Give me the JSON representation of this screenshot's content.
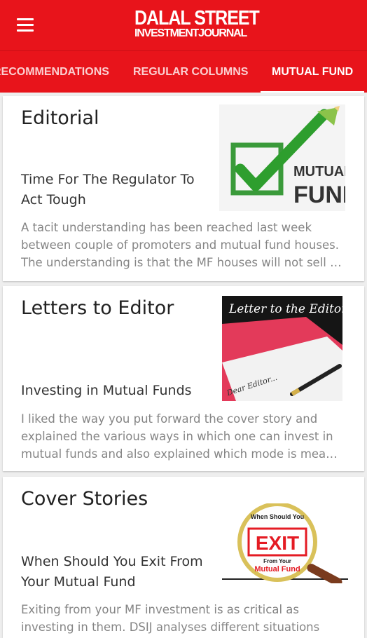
{
  "app": {
    "logo_line1": "DALAL STREET",
    "logo_line2": "INVESTMENTJOURNAL"
  },
  "tabs": [
    {
      "label": "RECOMMENDATIONS",
      "active": false
    },
    {
      "label": "REGULAR COLUMNS",
      "active": false
    },
    {
      "label": "MUTUAL FUND",
      "active": true
    }
  ],
  "colors": {
    "brand": "#e8141b",
    "tab_text": "#fbd0d1"
  },
  "cards": [
    {
      "section": "Editorial",
      "headline": "Time For The Regulator To Act Tough",
      "description_lines": [
        "A tacit understanding has been reached last week",
        "between couple of promoters and mutual fund houses.",
        "The understanding is that the MF houses will not sell …"
      ],
      "image": {
        "line1": "MUTUAL",
        "line2": "FUND",
        "icon": "checkmark-pencil-icon"
      }
    },
    {
      "section": "Letters to Editor",
      "headline": "Investing in Mutual Funds",
      "description_lines": [
        "I liked the way you put forward the cover story and",
        "explained the various ways in which one can invest in",
        "mutual funds and also explained which mode is mea…"
      ],
      "image": {
        "title": "Letter to the Editor",
        "handwriting": "Dear Editor...",
        "icon": "fountain-pen-icon"
      }
    },
    {
      "section": "Cover Stories",
      "headline": "When Should You Exit From Your Mutual Fund",
      "description_lines": [
        "Exiting from your MF investment is as critical as",
        "investing in them. DSIJ analyses different situations"
      ],
      "image": {
        "top": "When Should You",
        "exit": "EXIT",
        "from": "From Your",
        "mf": "Mutual Fund",
        "icon": "magnifier-icon"
      }
    }
  ]
}
